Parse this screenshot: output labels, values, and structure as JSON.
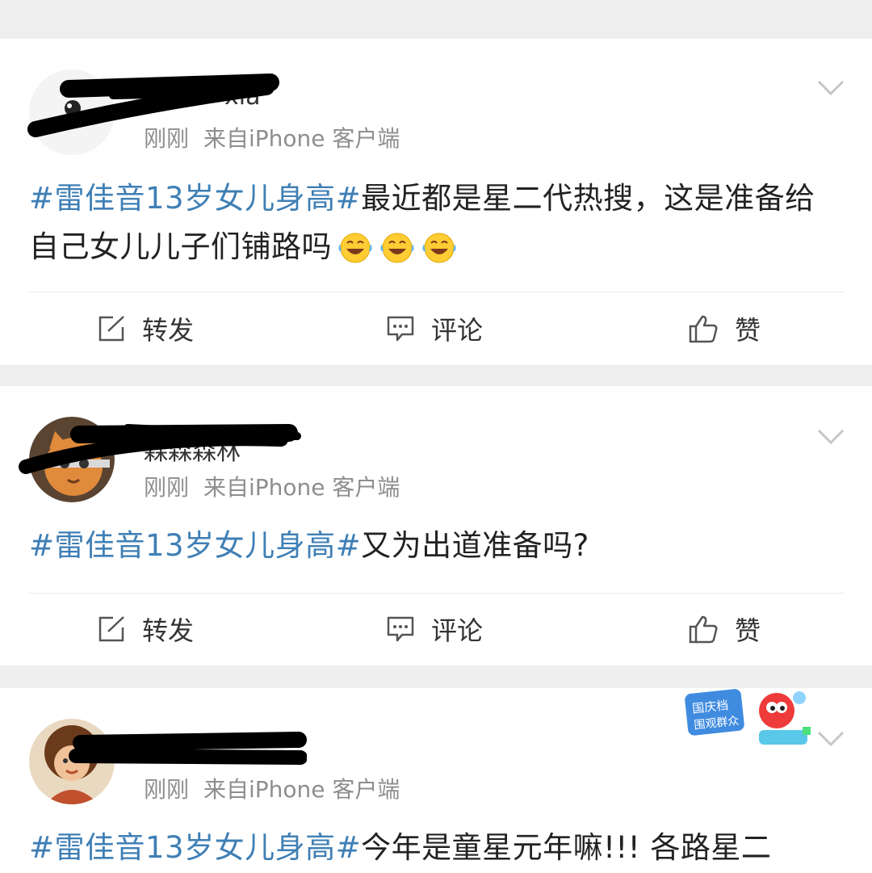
{
  "posts": [
    {
      "username": "xia",
      "time": "刚刚",
      "source": "来自iPhone 客户端",
      "hashtag": "#雷佳音13岁女儿身高#",
      "text": "最近都是星二代热搜，这是准备给自己女儿儿子们铺路吗",
      "emoji": [
        "laugh-cry-emoji",
        "laugh-cry-emoji",
        "laugh-cry-emoji"
      ]
    },
    {
      "username": "森森森林",
      "time": "刚刚",
      "source": "来自iPhone 客户端",
      "hashtag": "#雷佳音13岁女儿身高#",
      "text": "又为出道准备吗?"
    },
    {
      "username": "",
      "time": "刚刚",
      "source": "来自iPhone 客户端",
      "hashtag": "#雷佳音13岁女儿身高#",
      "text": "今年是童星元年嘛!!! 各路星二"
    }
  ],
  "actions": {
    "repost": "转发",
    "comment": "评论",
    "like": "赞"
  },
  "badge": {
    "line1": "国庆档",
    "line2": "围观群众"
  },
  "colors": {
    "hashtag": "#3f7fb5",
    "meta": "#8e8e8e",
    "background": "#eeeeee"
  }
}
